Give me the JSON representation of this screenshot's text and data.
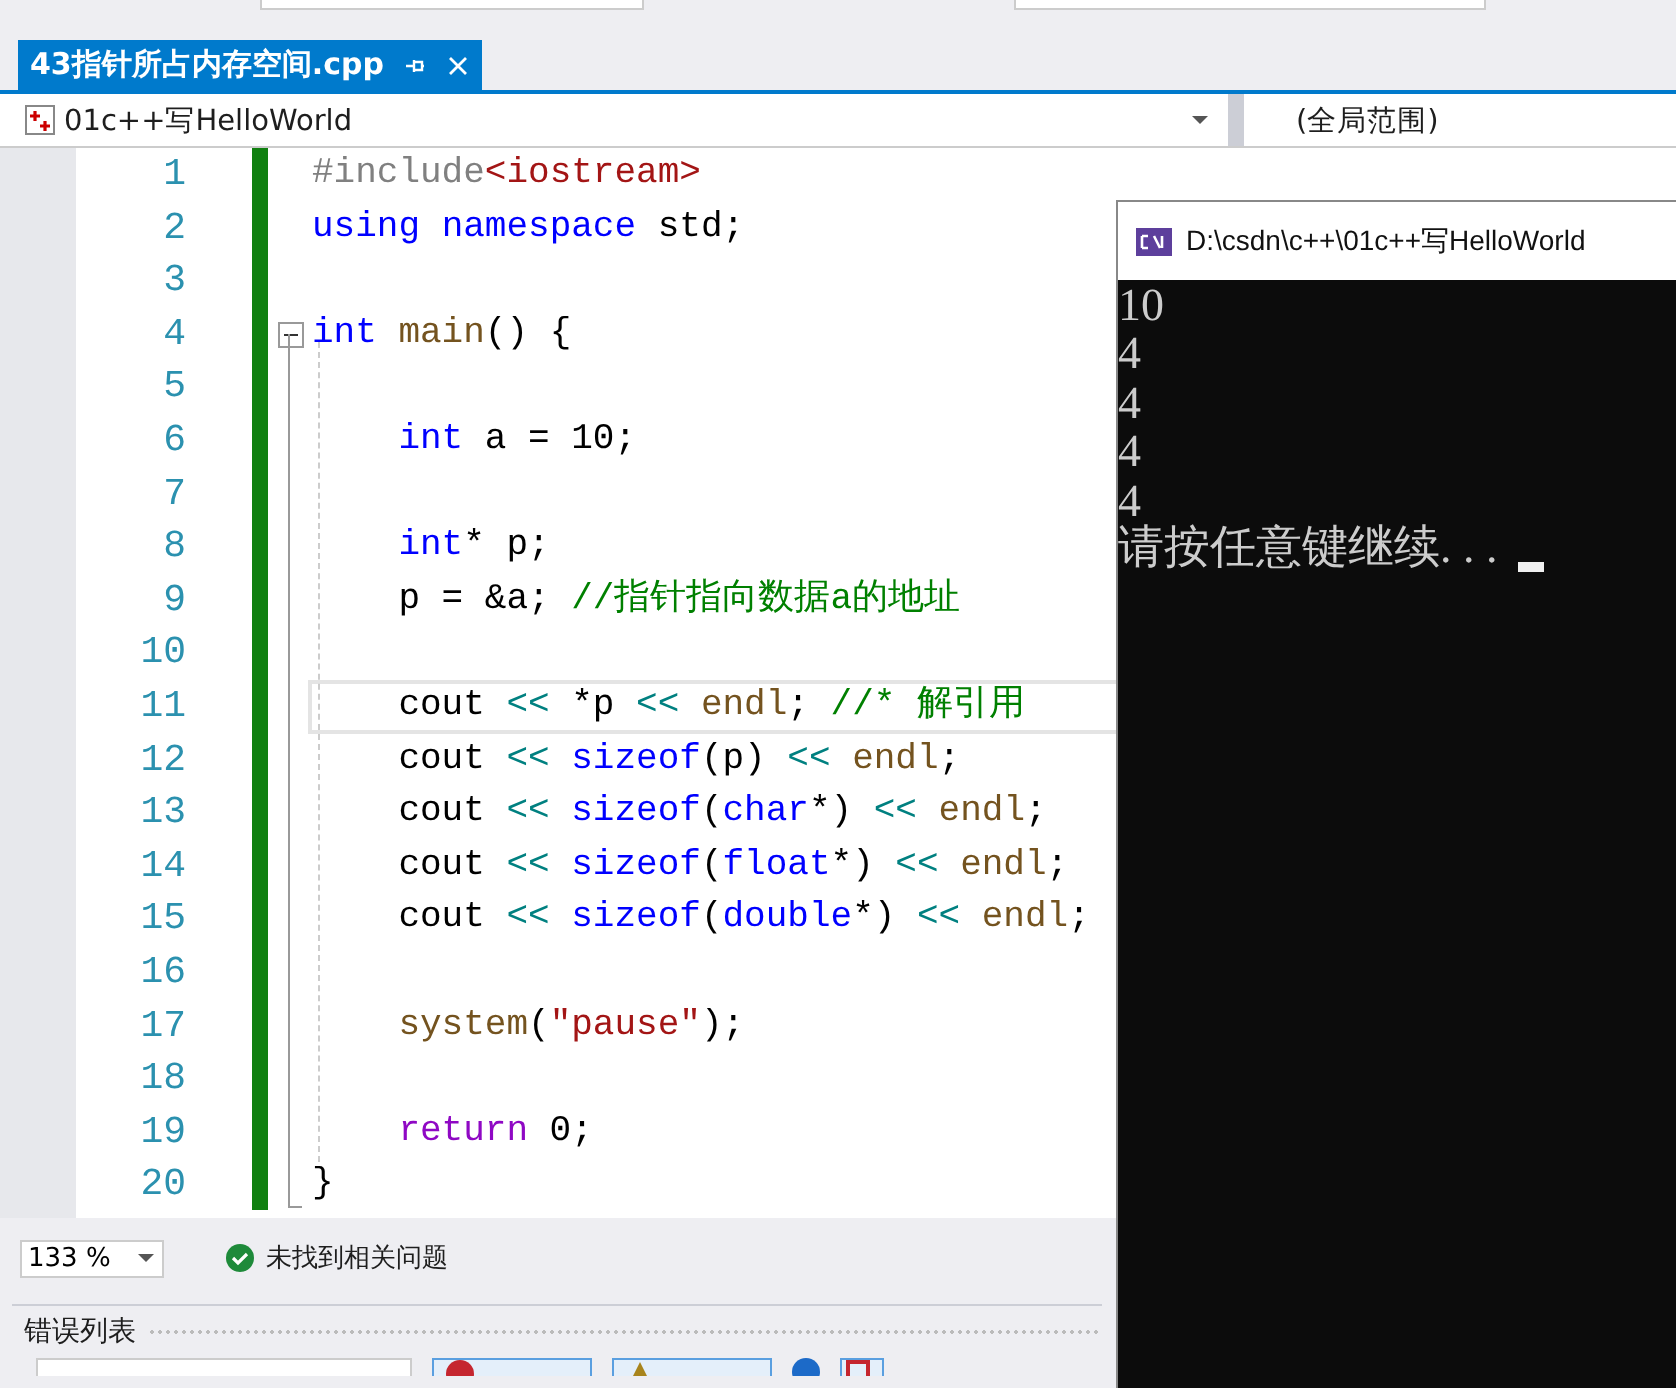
{
  "tab": {
    "title": "43指针所占内存空间.cpp",
    "selected": true
  },
  "navigation": {
    "project": "01c++写HelloWorld",
    "scope": "(全局范围)"
  },
  "editor": {
    "lines": [
      {
        "number": "1",
        "current": false,
        "tokens": [
          {
            "kind": "preproc",
            "text": "#include"
          },
          {
            "kind": "string",
            "text": "<iostream>"
          }
        ]
      },
      {
        "number": "2",
        "current": false,
        "tokens": [
          {
            "kind": "keyword",
            "text": "using"
          },
          {
            "kind": "keyword",
            "text": " namespace"
          },
          {
            "kind": "plain",
            "text": " std;"
          }
        ]
      },
      {
        "number": "3",
        "current": false
      },
      {
        "number": "4",
        "current": false,
        "expanded": true,
        "tokens": [
          {
            "kind": "keyword",
            "text": "int"
          },
          {
            "kind": "func",
            "text": " main"
          },
          {
            "kind": "plain",
            "text": "() {"
          }
        ],
        "children": [
          {
            "number": "5",
            "current": false
          },
          {
            "number": "6",
            "current": false,
            "tokens": [
              {
                "kind": "keyword",
                "text": "int"
              },
              {
                "kind": "plain",
                "text": " a = 10;"
              }
            ]
          },
          {
            "number": "7",
            "current": false
          },
          {
            "number": "8",
            "current": false,
            "tokens": [
              {
                "kind": "keyword",
                "text": "int"
              },
              {
                "kind": "plain",
                "text": "* p;"
              }
            ]
          },
          {
            "number": "9",
            "current": false,
            "tokens": [
              {
                "kind": "plain",
                "text": "p = &a; "
              },
              {
                "kind": "comment",
                "text": "//指针指向数据a的地址"
              }
            ]
          },
          {
            "number": "10",
            "current": false
          },
          {
            "number": "11",
            "current": true,
            "tokens": [
              {
                "kind": "plain",
                "text": "cout "
              },
              {
                "kind": "op",
                "text": "<<"
              },
              {
                "kind": "plain",
                "text": " *p "
              },
              {
                "kind": "op",
                "text": "<<"
              },
              {
                "kind": "func",
                "text": " endl"
              },
              {
                "kind": "plain",
                "text": "; "
              },
              {
                "kind": "comment",
                "text": "//* 解引用"
              }
            ]
          },
          {
            "number": "12",
            "current": false,
            "tokens": [
              {
                "kind": "plain",
                "text": "cout "
              },
              {
                "kind": "op",
                "text": "<<"
              },
              {
                "kind": "keyword",
                "text": " sizeof"
              },
              {
                "kind": "plain",
                "text": "(p) "
              },
              {
                "kind": "op",
                "text": "<<"
              },
              {
                "kind": "func",
                "text": " endl"
              },
              {
                "kind": "plain",
                "text": ";"
              }
            ]
          },
          {
            "number": "13",
            "current": false,
            "tokens": [
              {
                "kind": "plain",
                "text": "cout "
              },
              {
                "kind": "op",
                "text": "<<"
              },
              {
                "kind": "keyword",
                "text": " sizeof"
              },
              {
                "kind": "plain",
                "text": "("
              },
              {
                "kind": "keyword",
                "text": "char"
              },
              {
                "kind": "plain",
                "text": "*) "
              },
              {
                "kind": "op",
                "text": "<<"
              },
              {
                "kind": "func",
                "text": " endl"
              },
              {
                "kind": "plain",
                "text": ";"
              }
            ]
          },
          {
            "number": "14",
            "current": false,
            "tokens": [
              {
                "kind": "plain",
                "text": "cout "
              },
              {
                "kind": "op",
                "text": "<<"
              },
              {
                "kind": "keyword",
                "text": " sizeof"
              },
              {
                "kind": "plain",
                "text": "("
              },
              {
                "kind": "keyword",
                "text": "float"
              },
              {
                "kind": "plain",
                "text": "*) "
              },
              {
                "kind": "op",
                "text": "<<"
              },
              {
                "kind": "func",
                "text": " endl"
              },
              {
                "kind": "plain",
                "text": ";"
              }
            ]
          },
          {
            "number": "15",
            "current": false,
            "tokens": [
              {
                "kind": "plain",
                "text": "cout "
              },
              {
                "kind": "op",
                "text": "<<"
              },
              {
                "kind": "keyword",
                "text": " sizeof"
              },
              {
                "kind": "plain",
                "text": "("
              },
              {
                "kind": "keyword",
                "text": "double"
              },
              {
                "kind": "plain",
                "text": "*) "
              },
              {
                "kind": "op",
                "text": "<<"
              },
              {
                "kind": "func",
                "text": " endl"
              },
              {
                "kind": "plain",
                "text": ";"
              }
            ]
          },
          {
            "number": "16",
            "current": false
          },
          {
            "number": "17",
            "current": false,
            "tokens": [
              {
                "kind": "func",
                "text": "system"
              },
              {
                "kind": "plain",
                "text": "("
              },
              {
                "kind": "string",
                "text": "\"pause\""
              },
              {
                "kind": "plain",
                "text": ");"
              }
            ]
          },
          {
            "number": "18",
            "current": false
          },
          {
            "number": "19",
            "current": false,
            "tokens": [
              {
                "kind": "control",
                "text": "return"
              },
              {
                "kind": "plain",
                "text": " 0;"
              }
            ]
          }
        ]
      },
      {
        "number": "20",
        "current": false,
        "tokens": [
          {
            "kind": "plain",
            "text": "}"
          }
        ]
      }
    ]
  },
  "status": {
    "zoom": "133 %",
    "issues": "未找到相关问题"
  },
  "error_list": {
    "title": "错误列表"
  },
  "console": {
    "title": "D:\\csdn\\c++\\01c++写HelloWorld",
    "output": [
      "10",
      "4",
      "4",
      "4",
      "4",
      "请按任意键继续. . ."
    ]
  }
}
